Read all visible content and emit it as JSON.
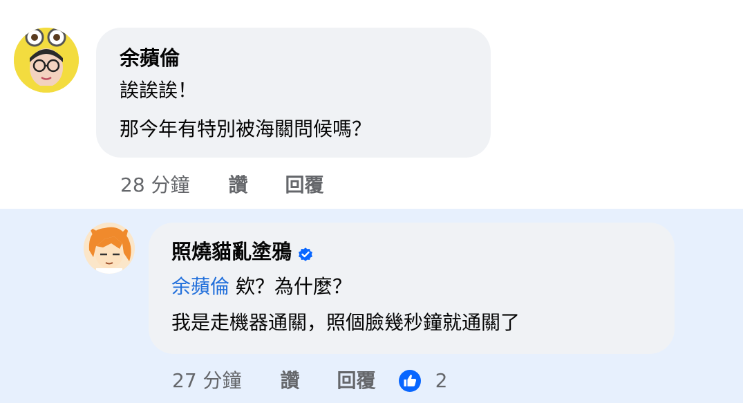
{
  "comments": [
    {
      "author": "余蘋倫",
      "lines": [
        "誒誒誒！",
        "那今年有特別被海關問候嗎？"
      ],
      "time": "28 分鐘",
      "like_label": "讚",
      "reply_label": "回覆",
      "highlighted": false
    },
    {
      "author": "照燒貓亂塗鴉",
      "verified": true,
      "mention": "余蘋倫",
      "line1_text": " 欸？為什麼？",
      "line2": "我是走機器通關，照個臉幾秒鐘就通關了",
      "time": "27 分鐘",
      "like_label": "讚",
      "reply_label": "回覆",
      "reaction_icon": "thumbs-up-icon",
      "reaction_count": "2",
      "highlighted": true
    }
  ],
  "colors": {
    "bubble": "#f0f2f5",
    "highlight_bg": "#e7f0fd",
    "mention": "#216fdb",
    "meta": "#65676b",
    "like_blue": "#0866ff"
  }
}
